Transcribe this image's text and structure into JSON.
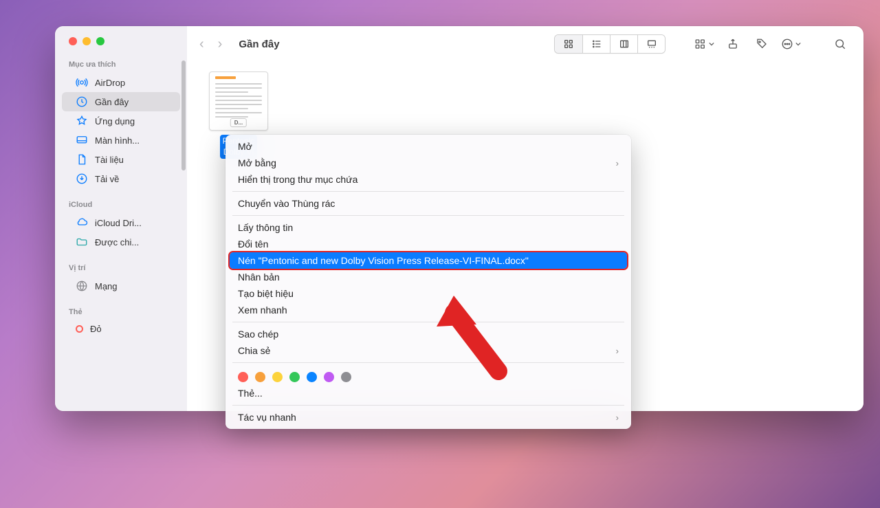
{
  "toolbar": {
    "title": "Gần đây"
  },
  "sidebar": {
    "favorites_title": "Mục ưa thích",
    "items": [
      "AirDrop",
      "Gần đây",
      "Ứng dụng",
      "Màn hình...",
      "Tài liệu",
      "Tải về"
    ],
    "icloud_title": "iCloud",
    "icloud_items": [
      "iCloud Dri...",
      "Được chi..."
    ],
    "locations_title": "Vị trí",
    "locations_items": [
      "Mạng"
    ],
    "tags_title": "Thẻ",
    "tags": [
      "Đỏ"
    ]
  },
  "file": {
    "name_line1": "Pentonic",
    "name_line2": "Dolby Vi",
    "ext": "D..."
  },
  "menu": {
    "open": "Mở",
    "open_with": "Mở bằng",
    "show_in_folder": "Hiển thị trong thư mục chứa",
    "move_to_trash": "Chuyển vào Thùng rác",
    "get_info": "Lấy thông tin",
    "rename": "Đổi tên",
    "compress": "Nén \"Pentonic and new Dolby Vision Press Release-VI-FINAL.docx\"",
    "duplicate": "Nhân bản",
    "make_alias": "Tạo biệt hiệu",
    "quick_look": "Xem nhanh",
    "copy": "Sao chép",
    "share": "Chia sẻ",
    "tags_label": "Thẻ...",
    "quick_actions": "Tác vụ nhanh"
  },
  "tag_colors": [
    "#ff5f57",
    "#f7a03c",
    "#fcd33c",
    "#34c759",
    "#0a84ff",
    "#bf5af2",
    "#8e8e93"
  ]
}
